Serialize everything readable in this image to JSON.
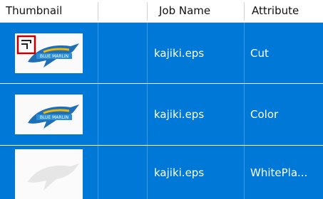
{
  "columns": {
    "thumbnail": "Thumbnail",
    "blank": "",
    "job_name": "Job Name",
    "attribute": "Attribute"
  },
  "rows": [
    {
      "job_name": "kajiki.eps",
      "attribute": "Cut",
      "thumbnail": "marlin-thumbnail-with-cut-mark"
    },
    {
      "job_name": "kajiki.eps",
      "attribute": "Color",
      "thumbnail": "marlin-thumbnail-color"
    },
    {
      "job_name": "kajiki.eps",
      "attribute": "WhitePla...",
      "thumbnail": "marlin-silhouette-white"
    }
  ],
  "colors": {
    "selection": "#0078d7",
    "header_bg": "#ffffff",
    "cut_mark": "#c00000"
  }
}
